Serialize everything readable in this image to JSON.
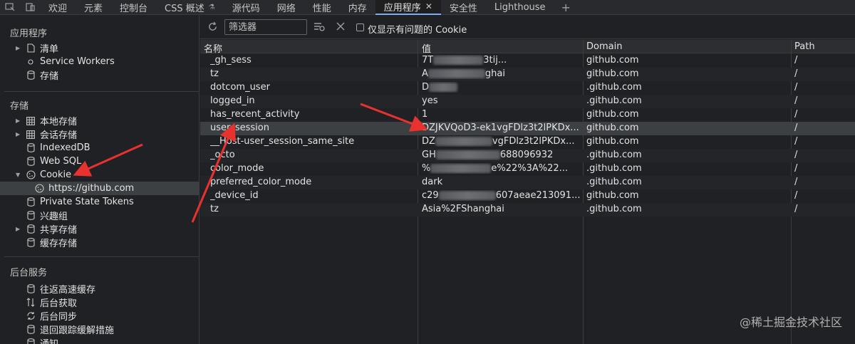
{
  "tabs": [
    {
      "label": "欢迎"
    },
    {
      "label": "元素"
    },
    {
      "label": "控制台"
    },
    {
      "label": "CSS 概述"
    },
    {
      "label": "源代码"
    },
    {
      "label": "网络"
    },
    {
      "label": "性能"
    },
    {
      "label": "内存"
    },
    {
      "label": "应用程序",
      "active": true
    },
    {
      "label": "安全性"
    },
    {
      "label": "Lighthouse"
    }
  ],
  "sidebar": {
    "app_title": "应用程序",
    "app_items": [
      {
        "label": "清单",
        "icon": "file-icon",
        "expandable": true
      },
      {
        "label": "Service Workers",
        "icon": "gear-icon",
        "expandable": false
      },
      {
        "label": "存储",
        "icon": "database-icon",
        "expandable": false
      }
    ],
    "storage_title": "存储",
    "storage_items": [
      {
        "label": "本地存储",
        "icon": "grid-icon",
        "expandable": true
      },
      {
        "label": "会话存储",
        "icon": "grid-icon",
        "expandable": true
      },
      {
        "label": "IndexedDB",
        "icon": "database-icon",
        "expandable": false
      },
      {
        "label": "Web SQL",
        "icon": "database-icon",
        "expandable": false
      },
      {
        "label": "Cookie",
        "icon": "cookie-icon",
        "expandable": true,
        "expanded": true
      },
      {
        "label": "https://github.com",
        "icon": "cookie-icon",
        "child": true,
        "selected": true
      },
      {
        "label": "Private State Tokens",
        "icon": "database-icon",
        "expandable": false
      },
      {
        "label": "兴趣组",
        "icon": "database-icon",
        "expandable": false
      },
      {
        "label": "共享存储",
        "icon": "database-icon",
        "expandable": true
      },
      {
        "label": "缓存存储",
        "icon": "database-icon",
        "expandable": false
      }
    ],
    "bg_title": "后台服务",
    "bg_items": [
      {
        "label": "往返高速缓存",
        "icon": "database-icon"
      },
      {
        "label": "后台获取",
        "icon": "updown-arrows-icon"
      },
      {
        "label": "后台同步",
        "icon": "sync-icon"
      },
      {
        "label": "退回跟踪缓解措施",
        "icon": "database-icon"
      },
      {
        "label": "通知",
        "icon": "database-icon"
      }
    ]
  },
  "toolbar": {
    "filter_placeholder": "筛选器",
    "checkbox_label": "仅显示有问题的 Cookie"
  },
  "table": {
    "columns": [
      "名称",
      "值",
      "Domain",
      "Path"
    ],
    "rows": [
      {
        "name": "_gh_sess",
        "value_pre": "7T",
        "value_post": "3tij...",
        "domain": "github.com",
        "path": "/"
      },
      {
        "name": "tz",
        "value_pre": "A",
        "value_post": "ghai",
        "domain": "github.com",
        "path": "/"
      },
      {
        "name": "dotcom_user",
        "value_pre": "D",
        "value_post": "",
        "domain": ".github.com",
        "path": "/"
      },
      {
        "name": "logged_in",
        "value_pre": "yes",
        "value_post": "",
        "domain": ".github.com",
        "path": "/"
      },
      {
        "name": "has_recent_activity",
        "value_pre": "1",
        "value_post": "",
        "domain": "github.com",
        "path": "/"
      },
      {
        "name": "user_session",
        "value_pre": "DZJKVQoD3-ek1vgFDlz3t2lPKDx...",
        "value_post": "",
        "domain": "github.com",
        "path": "/",
        "selected": true
      },
      {
        "name": "__Host-user_session_same_site",
        "value_pre": "DZ",
        "value_post": "vgFDlz3t2lPKDx...",
        "domain": "github.com",
        "path": "/"
      },
      {
        "name": "_octo",
        "value_pre": "GH",
        "value_post": "688096932",
        "domain": ".github.com",
        "path": "/"
      },
      {
        "name": "color_mode",
        "value_pre": "%",
        "value_post": "e%22%3A%22...",
        "domain": ".github.com",
        "path": "/"
      },
      {
        "name": "preferred_color_mode",
        "value_pre": "dark",
        "value_post": "",
        "domain": ".github.com",
        "path": "/"
      },
      {
        "name": "_device_id",
        "value_pre": "c29",
        "value_post": "607aeae213091...",
        "domain": "github.com",
        "path": "/"
      },
      {
        "name": "tz",
        "value_pre": "Asia%2FShanghai",
        "value_post": "",
        "domain": ".github.com",
        "path": "/"
      }
    ]
  },
  "watermark": "@稀土掘金技术社区",
  "colors": {
    "accent": "#7cacf8",
    "arrow": "#e8322f",
    "panel": "#202124"
  }
}
